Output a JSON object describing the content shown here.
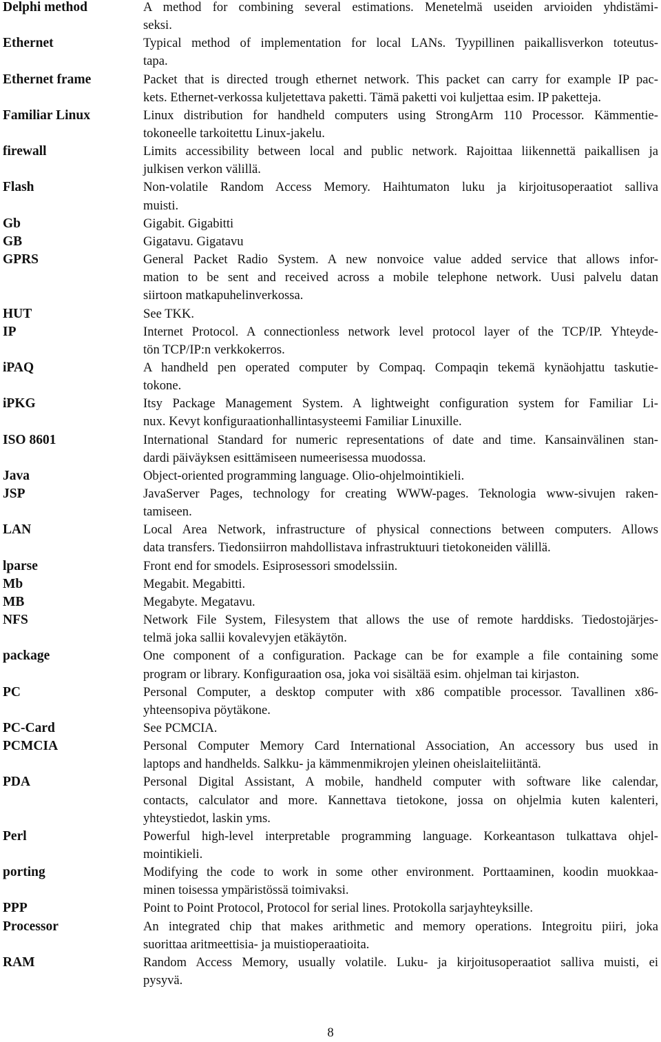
{
  "page": {
    "number": "8"
  },
  "glossary": [
    {
      "term": "Delphi method",
      "lines": [
        "A method for combining several estimations. Menetelmä useiden arvioiden yhdistämi-",
        "seksi."
      ]
    },
    {
      "term": "Ethernet",
      "lines": [
        "Typical method of implementation for local LANs. Tyypillinen paikallisverkon toteutus-",
        "tapa."
      ]
    },
    {
      "term": "Ethernet frame",
      "lines": [
        "Packet that is directed trough ethernet network. This packet can carry for example IP pac-",
        "kets. Ethernet-verkossa kuljetettava paketti. Tämä paketti voi kuljettaa esim. IP paketteja."
      ]
    },
    {
      "term": "Familiar Linux",
      "lines": [
        "Linux distribution for handheld computers using StrongArm 110 Processor. Kämmentie-",
        "tokoneelle tarkoitettu Linux-jakelu."
      ]
    },
    {
      "term": "firewall",
      "lines": [
        "Limits accessibility between local and public network. Rajoittaa liikennettä paikallisen ja",
        "julkisen verkon välillä."
      ]
    },
    {
      "term": "Flash",
      "lines": [
        "Non-volatile Random Access Memory. Haihtumaton luku ja kirjoitusoperaatiot salliva",
        "muisti."
      ]
    },
    {
      "term": "Gb",
      "lines": [
        "Gigabit. Gigabitti"
      ]
    },
    {
      "term": "GB",
      "lines": [
        "Gigatavu. Gigatavu"
      ]
    },
    {
      "term": "GPRS",
      "lines": [
        "General Packet Radio System. A new nonvoice value added service that allows infor-",
        "mation to be sent and received across a mobile telephone network. Uusi palvelu datan",
        "siirtoon matkapuhelinverkossa."
      ]
    },
    {
      "term": "HUT",
      "lines": [
        "See TKK."
      ]
    },
    {
      "term": "IP",
      "lines": [
        "Internet Protocol. A connectionless network level protocol layer of the TCP/IP. Yhteyde-",
        "tön TCP/IP:n verkkokerros."
      ]
    },
    {
      "term": "iPAQ",
      "lines": [
        "A handheld pen operated computer by Compaq. Compaqin tekemä kynäohjattu taskutie-",
        "tokone."
      ]
    },
    {
      "term": "iPKG",
      "lines": [
        "Itsy Package Management System. A lightweight configuration system for Familiar Li-",
        "nux. Kevyt konfiguraationhallintasysteemi Familiar Linuxille."
      ]
    },
    {
      "term": "ISO 8601",
      "lines": [
        "International Standard for numeric representations of date and time. Kansainvälinen stan-",
        "dardi päiväyksen esittämiseen numeerisessa muodossa."
      ]
    },
    {
      "term": "Java",
      "lines": [
        "Object-oriented programming language. Olio-ohjelmointikieli."
      ]
    },
    {
      "term": "JSP",
      "lines": [
        "JavaServer Pages, technology for creating WWW-pages. Teknologia www-sivujen raken-",
        "tamiseen."
      ]
    },
    {
      "term": "LAN",
      "lines": [
        "Local Area Network, infrastructure of physical connections between computers. Allows",
        "data transfers. Tiedonsiirron mahdollistava infrastruktuuri tietokoneiden välillä."
      ]
    },
    {
      "term": "lparse",
      "lines": [
        "Front end for smodels. Esiprosessori smodelssiin."
      ]
    },
    {
      "term": "Mb",
      "lines": [
        "Megabit. Megabitti."
      ]
    },
    {
      "term": "MB",
      "lines": [
        "Megabyte. Megatavu."
      ]
    },
    {
      "term": "NFS",
      "lines": [
        "Network File System, Filesystem that allows the use of remote harddisks. Tiedostojärjes-",
        "telmä joka sallii kovalevyjen etäkäytön."
      ]
    },
    {
      "term": "package",
      "lines": [
        "One component of a configuration. Package can be for example a file containing some",
        "program or library. Konfiguraation osa, joka voi sisältää esim. ohjelman tai kirjaston."
      ]
    },
    {
      "term": "PC",
      "lines": [
        "Personal Computer, a desktop computer with x86 compatible processor. Tavallinen x86-",
        "yhteensopiva pöytäkone."
      ]
    },
    {
      "term": "PC-Card",
      "lines": [
        "See PCMCIA."
      ]
    },
    {
      "term": "PCMCIA",
      "lines": [
        "Personal Computer Memory Card International Association, An accessory bus used in",
        "laptops and handhelds. Salkku- ja kämmenmikrojen yleinen oheislaiteliitäntä."
      ]
    },
    {
      "term": "PDA",
      "lines": [
        "Personal Digital Assistant, A mobile, handheld computer with software like calendar,",
        "contacts, calculator and more. Kannettava tietokone, jossa on ohjelmia kuten kalenteri,",
        "yhteystiedot, laskin yms."
      ]
    },
    {
      "term": "Perl",
      "lines": [
        "Powerful high-level interpretable programming language. Korkeantason tulkattava ohjel-",
        "mointikieli."
      ]
    },
    {
      "term": "porting",
      "lines": [
        "Modifying the code to work in some other environment. Porttaaminen, koodin muokkaa-",
        "minen toisessa ympäristössä toimivaksi."
      ]
    },
    {
      "term": "PPP",
      "lines": [
        "Point to Point Protocol, Protocol for serial lines. Protokolla sarjayhteyksille."
      ]
    },
    {
      "term": "Processor",
      "lines": [
        "An integrated chip that makes arithmetic and memory operations. Integroitu piiri, joka",
        "suorittaa aritmeettisia- ja muistioperaatioita."
      ]
    },
    {
      "term": "RAM",
      "lines": [
        "Random Access Memory, usually volatile. Luku- ja kirjoitusoperaatiot salliva muisti, ei",
        "pysyvä."
      ]
    }
  ]
}
